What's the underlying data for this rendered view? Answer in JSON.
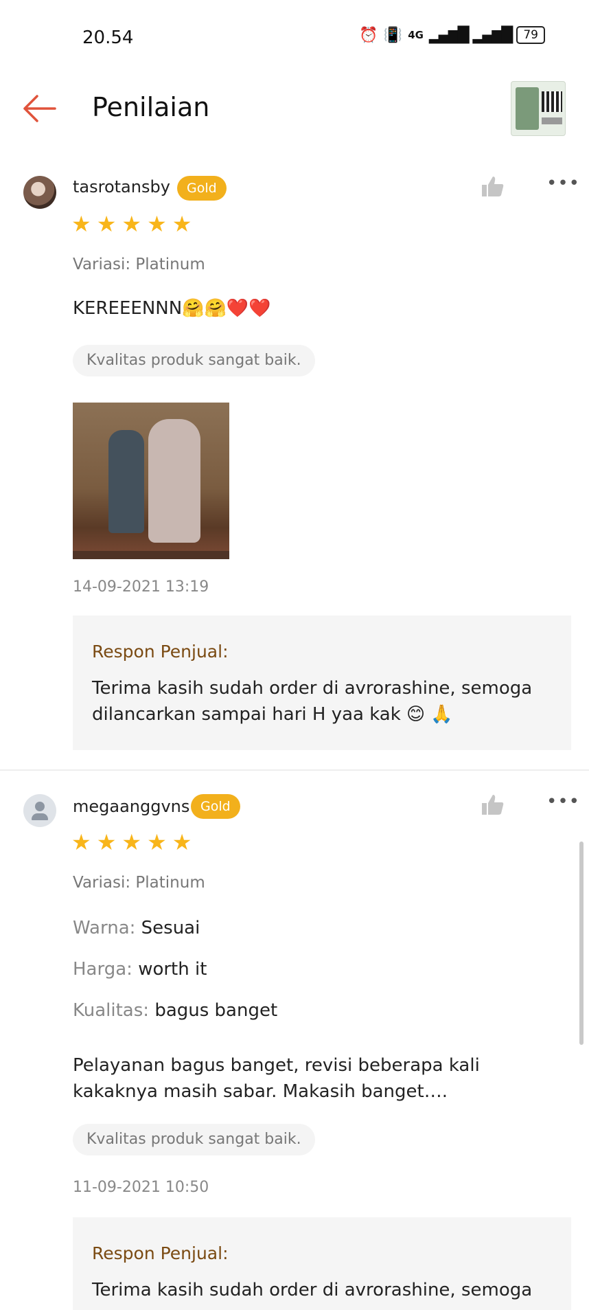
{
  "status_bar": {
    "time": "20.54",
    "network": "4G",
    "battery": "79"
  },
  "header": {
    "back_icon": "arrow-left-icon",
    "title": "Penilaian",
    "accent_color": "#e0533b"
  },
  "reviews": [
    {
      "username": "tasrotansby",
      "badge": "Gold",
      "stars": 5,
      "variation": "Variasi: Platinum",
      "comment": "KEREEENNN🤗🤗❤️❤️",
      "quality_chip": "Kvalitas produk sangat baik.",
      "date": "14-09-2021 13:19",
      "response_title": "Respon Penjual:",
      "response_text": "Terima kasih sudah order di avrorashine, semoga dilancarkan sampai hari H yaa kak 😊 🙏"
    },
    {
      "username": "megaanggvns",
      "badge": "Gold",
      "stars": 5,
      "variation": "Variasi: Platinum",
      "attributes": [
        {
          "key": "Warna:",
          "value": "Sesuai"
        },
        {
          "key": "Harga:",
          "value": "worth it"
        },
        {
          "key": "Kualitas:",
          "value": "bagus banget"
        }
      ],
      "comment": "Pelayanan bagus banget, revisi beberapa kali kakaknya masih sabar. Makasih banget….",
      "quality_chip": "Kvalitas produk sangat baik.",
      "date": "11-09-2021 10:50",
      "response_title": "Respon Penjual:",
      "response_text": "Terima kasih sudah order di avrorashine, semoga"
    }
  ],
  "star_color": "#f8b51a",
  "badge_color": "#f2b01c"
}
